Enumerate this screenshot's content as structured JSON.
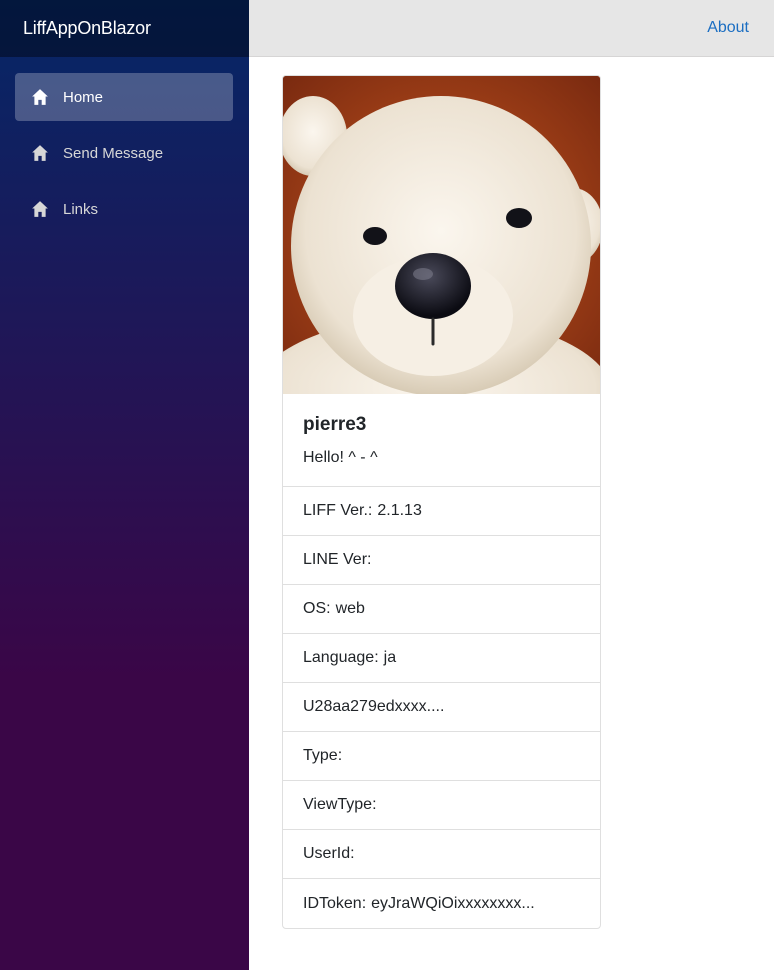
{
  "sidebar": {
    "brand": "LiffAppOnBlazor",
    "items": [
      {
        "label": "Home",
        "icon": "home-icon",
        "active": true
      },
      {
        "label": "Send Message",
        "icon": "home-icon",
        "active": false
      },
      {
        "label": "Links",
        "icon": "home-icon",
        "active": false
      }
    ]
  },
  "header": {
    "about_label": "About"
  },
  "profile": {
    "image": "teddy-bear-avatar",
    "name": "pierre3",
    "status_message": "Hello! ^ - ^"
  },
  "info": [
    {
      "label": "LIFF Ver.:",
      "value": "2.1.13"
    },
    {
      "label": "LINE Ver:",
      "value": ""
    },
    {
      "label": "OS:",
      "value": "web"
    },
    {
      "label": "Language:",
      "value": "ja"
    },
    {
      "label": "",
      "value": "U28aa279edxxxx...."
    },
    {
      "label": "Type:",
      "value": ""
    },
    {
      "label": "ViewType:",
      "value": ""
    },
    {
      "label": "UserId:",
      "value": ""
    },
    {
      "label": "IDToken:",
      "value": "eyJraWQiOixxxxxxxx..."
    }
  ],
  "colors": {
    "accent_link": "#1b6ec2",
    "sidebar_top": "#052767",
    "sidebar_bottom": "#3a0647"
  }
}
